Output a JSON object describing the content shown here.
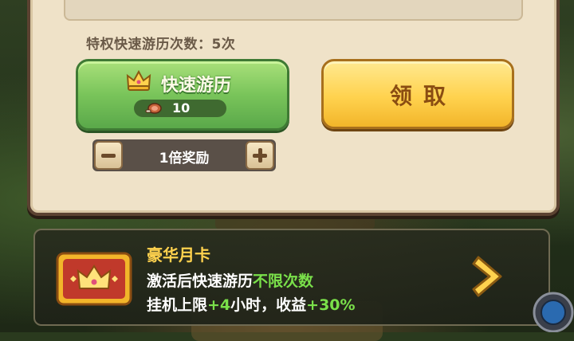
{
  "panel": {
    "privilege_label": "特权快速游历次数：5次",
    "quick_travel": {
      "label": "快速游历",
      "cost": "10"
    },
    "claim_button": "领取",
    "multiplier": "1倍奖励"
  },
  "monthly_card": {
    "title": "豪华月卡",
    "line1_prefix": "激活后快速游历",
    "line1_highlight": "不限次数",
    "line2_a": "挂机上限",
    "line2_b": "+4",
    "line2_c": "小时，收益",
    "line2_d": "+30%"
  },
  "colors": {
    "green_button": "#79c45a",
    "yellow_button": "#ffd24e",
    "highlight": "#7ae04a",
    "title": "#ffd24e"
  }
}
